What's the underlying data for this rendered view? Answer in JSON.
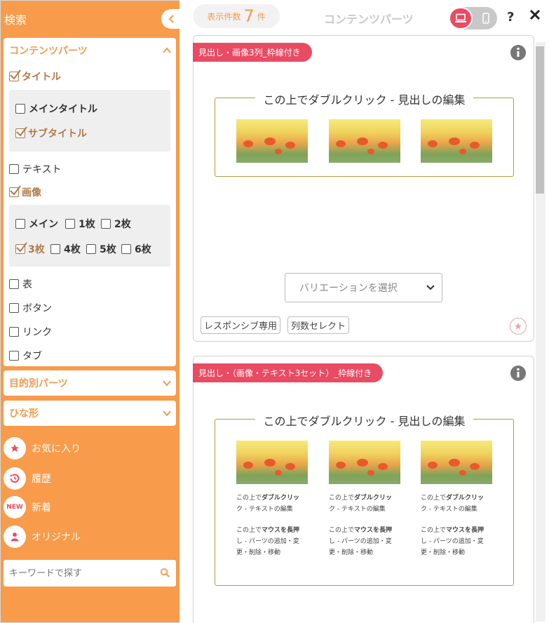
{
  "sidebar": {
    "title": "検索",
    "contents_section": {
      "title": "コンテンツパーツ",
      "title_group": {
        "label": "タイトル",
        "children": [
          "メインタイトル",
          "サブタイトル"
        ]
      },
      "text": "テキスト",
      "image_group": {
        "label": "画像",
        "options": [
          "メイン",
          "1枚",
          "2枚",
          "3枚",
          "4枚",
          "5枚",
          "6枚"
        ]
      },
      "table": "表",
      "button": "ボタン",
      "link": "リンク",
      "tab": "タブ"
    },
    "purpose_section": "目的別パーツ",
    "template_section": "ひな形",
    "links": {
      "favorites": "お気に入り",
      "history": "履歴",
      "new_badge": "NEW",
      "new": "新着",
      "original": "オリジナル"
    },
    "search_placeholder": "キーワードで探す"
  },
  "topbar": {
    "count_label": "表示件数",
    "count_value": "7",
    "count_unit": "件",
    "title": "コンテンツパーツ",
    "help": "?"
  },
  "cards": [
    {
      "tag": "見出し・画像3列_枠線付き",
      "frame_title": "この上でダブルクリック - 見出しの編集",
      "variation_placeholder": "バリエーションを選択",
      "tags": [
        "レスポンシブ専用",
        "列数セレクト"
      ]
    },
    {
      "tag": "見出し・（画像・テキスト3セット）_枠線付き",
      "frame_title": "この上でダブルクリック - 見出しの編集",
      "caption_line1_prefix": "この上で",
      "caption_line1_bold": "ダブルクリッ",
      "caption_line2": "ク - テキストの編集",
      "caption_line3_prefix": "この上で",
      "caption_line3_bold": "マウスを長押",
      "caption_line4": "し - パーツの追加・変",
      "caption_line5": "更・削除・移動"
    }
  ],
  "colors": {
    "accent_orange": "#f89b4b",
    "accent_red": "#e94b63",
    "frame_gold": "#b59a3b"
  }
}
